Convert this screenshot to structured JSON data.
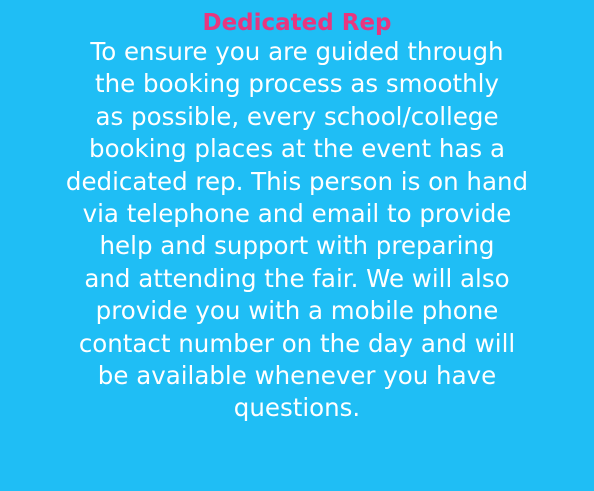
{
  "section": {
    "title": "Dedicated Rep",
    "lines": [
      "To ensure you are guided through",
      "the booking process as smoothly",
      "as possible, every school/college",
      "booking places at the event has a",
      "dedicated rep. This person is on hand",
      "via telephone and email to provide",
      "help and support with preparing",
      "and attending the fair. We will also",
      "provide you with a mobile phone",
      "contact number on the day and will",
      "be available whenever you have",
      "questions."
    ]
  },
  "colors": {
    "background": "#1fbef5",
    "title": "#e8367f",
    "text": "#ffffff"
  }
}
